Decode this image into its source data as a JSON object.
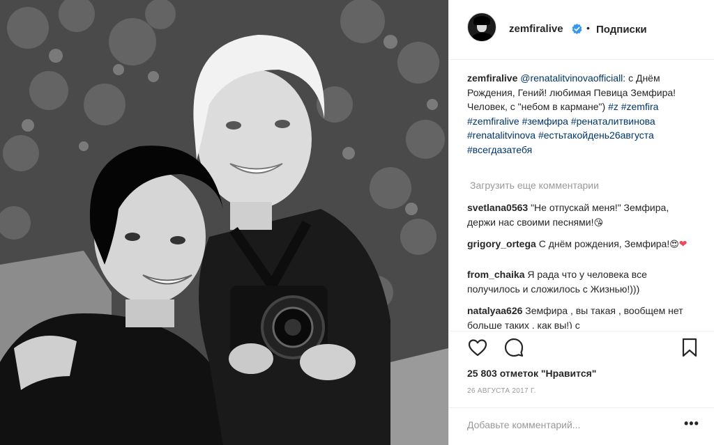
{
  "photo": {
    "icon": "photo-two-women-with-camera"
  },
  "header": {
    "username": "zemfiralive",
    "separator": "•",
    "follow_label": "Подписки",
    "verified_icon": "verified-badge-icon",
    "verified_color": "#3897f0"
  },
  "caption": {
    "user": "zemfiralive",
    "mention": "@renatalitvinovaofficiall",
    "text_after_mention": ":",
    "body": "с Днём Рождения, Гений! любимая Певица Земфира! Человек, с \"небом в кармане\")",
    "hashtags": "#z #zemfira #zemfiralive #земфира #ренаталитвинова #renatalitvinova #естьтакойдень26августа #всегдазатебя"
  },
  "load_more": "Загрузить еще комментарии",
  "comments": [
    {
      "user": "svetlana0563",
      "text": "\"Не отпускай меня!\" Земфира, держи нас своими песнями!",
      "emoji": "😘"
    },
    {
      "user": "grigory_ortega",
      "text": "С днём рождения, Земфира!",
      "emoji": "😍",
      "heart": "❤"
    },
    {
      "user": "from_chaika",
      "text": "Я рада что у человека все получилось и сложилось с Жизнью!)))"
    },
    {
      "user": "natalyaa626",
      "text": "Земфира , вы такая , вообщем нет больше таких , как вы!) с"
    }
  ],
  "actions": {
    "like_icon": "heart-outline-icon",
    "comment_icon": "comment-bubble-icon",
    "save_icon": "bookmark-icon"
  },
  "likes_text": "25 803 отметок \"Нравится\"",
  "date": "26 АВГУСТА 2017 Г.",
  "add_comment_placeholder": "Добавьте комментарий...",
  "more_options": "•••",
  "colors": {
    "link": "#003569",
    "muted": "#999999",
    "border": "#efefef",
    "text": "#262626",
    "heart": "#ed4956"
  }
}
